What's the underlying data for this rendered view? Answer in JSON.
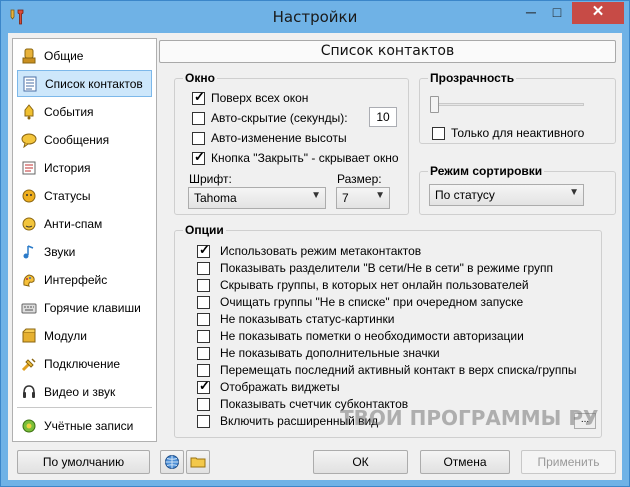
{
  "window": {
    "title": "Настройки",
    "minimize": "─",
    "maximize": "□",
    "close": "✕"
  },
  "sidebar": {
    "items": [
      {
        "label": "Общие",
        "icon": "general-icon"
      },
      {
        "label": "Список контактов",
        "icon": "contact-list-icon",
        "selected": true
      },
      {
        "label": "События",
        "icon": "events-icon"
      },
      {
        "label": "Сообщения",
        "icon": "messages-icon"
      },
      {
        "label": "История",
        "icon": "history-icon"
      },
      {
        "label": "Статусы",
        "icon": "statuses-icon"
      },
      {
        "label": "Анти-спам",
        "icon": "antispam-icon"
      },
      {
        "label": "Звуки",
        "icon": "sounds-icon"
      },
      {
        "label": "Интерфейс",
        "icon": "interface-icon"
      },
      {
        "label": "Горячие клавиши",
        "icon": "hotkeys-icon"
      },
      {
        "label": "Модули",
        "icon": "modules-icon"
      },
      {
        "label": "Подключение",
        "icon": "connection-icon"
      },
      {
        "label": "Видео и звук",
        "icon": "video-audio-icon"
      },
      {
        "label": "Учётные записи",
        "icon": "accounts-icon"
      }
    ]
  },
  "header": {
    "title": "Список контактов"
  },
  "window_group": {
    "label": "Окно",
    "options": [
      {
        "label": "Поверх всех окон",
        "checked": true
      },
      {
        "label": "Авто-скрытие (секунды):",
        "checked": false
      },
      {
        "label": "Авто-изменение высоты",
        "checked": false
      },
      {
        "label": "Кнопка \"Закрыть\" - скрывает окно",
        "checked": true
      }
    ],
    "autohide_seconds": "10",
    "font_label": "Шрифт:",
    "font_value": "Tahoma",
    "size_label": "Размер:",
    "size_value": "7"
  },
  "transparency": {
    "label": "Прозрачность",
    "level": 0,
    "inactive_only": {
      "label": "Только для неактивного",
      "checked": false
    }
  },
  "sort": {
    "label": "Режим сортировки",
    "value": "По статусу"
  },
  "options": {
    "label": "Опции",
    "items": [
      {
        "label": "Использовать режим метаконтактов",
        "checked": true
      },
      {
        "label": "Показывать разделители \"В сети/Не в сети\" в режиме групп",
        "checked": false
      },
      {
        "label": "Скрывать группы, в которых нет онлайн пользователей",
        "checked": false
      },
      {
        "label": "Очищать группы \"Не в списке\" при очередном запуске",
        "checked": false
      },
      {
        "label": "Не показывать статус-картинки",
        "checked": false
      },
      {
        "label": "Не показывать пометки о необходимости авторизации",
        "checked": false
      },
      {
        "label": "Не показывать дополнительные значки",
        "checked": false
      },
      {
        "label": "Перемещать последний активный контакт в верх списка/группы",
        "checked": false
      },
      {
        "label": "Отображать виджеты",
        "checked": true
      },
      {
        "label": "Показывать счетчик субконтактов",
        "checked": false
      },
      {
        "label": "Включить расширенный вид",
        "checked": false
      }
    ],
    "more_button": "..."
  },
  "watermark": "ТВОИ ПРОГРАММЫ РУ",
  "buttons": {
    "defaults": "По умолчанию",
    "ok": "ОК",
    "cancel": "Отмена",
    "apply": "Применить"
  }
}
